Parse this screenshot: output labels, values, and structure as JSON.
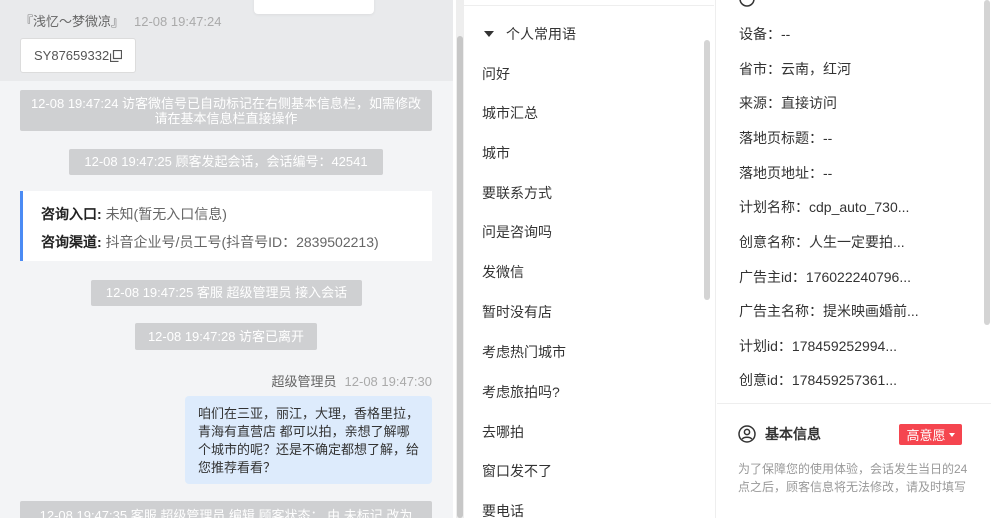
{
  "chat": {
    "visitor_name": "『浅忆～梦微凉』",
    "visitor_time": "12-08 19:47:24",
    "visitor_id": "SY87659332",
    "sys_messages": [
      "12-08 19:47:24 访客微信号已自动标记在右侧基本信息栏，如需修改请在基本信息栏直接操作",
      "12-08 19:47:25 顾客发起会话，会话编号：42541",
      "12-08 19:47:25 客服 超级管理员 接入会话",
      "12-08 19:47:28 访客已离开",
      "12-08 19:47:35 客服 超级管理员 编辑 顾客状态：  由 未标记 改为"
    ],
    "info_card": {
      "entry_label": "咨询入口:",
      "entry_value": "未知(暂无入口信息)",
      "channel_label": "咨询渠道:",
      "channel_value": "抖音企业号/员工号(抖音号ID：2839502213)"
    },
    "agent_name": "超级管理员",
    "agent_time": "12-08 19:47:30",
    "agent_message": "咱们在三亚，丽江，大理，香格里拉，青海有直营店 都可以拍，亲想了解哪个城市的呢？还是不确定都想了解，给您推荐看看？"
  },
  "phrases": {
    "group_title": "个人常用语",
    "items": [
      "问好",
      "城市汇总",
      "城市",
      "要联系方式",
      "问是咨询吗",
      "发微信",
      "暂时没有店",
      "考虑热门城市",
      "考虑旅拍吗?",
      "去哪拍",
      "窗口发不了",
      "要电话"
    ]
  },
  "detail": {
    "fields": [
      {
        "label": "设备：",
        "value": "--"
      },
      {
        "label": "省市：",
        "value": "云南，红河"
      },
      {
        "label": "来源：",
        "value": "直接访问"
      },
      {
        "label": "落地页标题：",
        "value": "--"
      },
      {
        "label": "落地页地址：",
        "value": "--"
      },
      {
        "label": "计划名称：",
        "value": "cdp_auto_730..."
      },
      {
        "label": "创意名称：",
        "value": "人生一定要拍..."
      },
      {
        "label": "广告主id：",
        "value": "176022240796..."
      },
      {
        "label": "广告主名称：",
        "value": "提米映画婚前..."
      },
      {
        "label": "计划id：",
        "value": "178459252994..."
      },
      {
        "label": "创意id：",
        "value": "178459257361..."
      }
    ],
    "basic_title": "基本信息",
    "intent_label": "高意愿",
    "notice": "为了保障您的使用体验，会话发生当日的24点之后，顾客信息将无法修改，请及时填写"
  },
  "colors": {
    "accent_blue": "#4b8bf4",
    "intent_red": "#f5454f",
    "bubble_blue": "#ddebfc"
  }
}
